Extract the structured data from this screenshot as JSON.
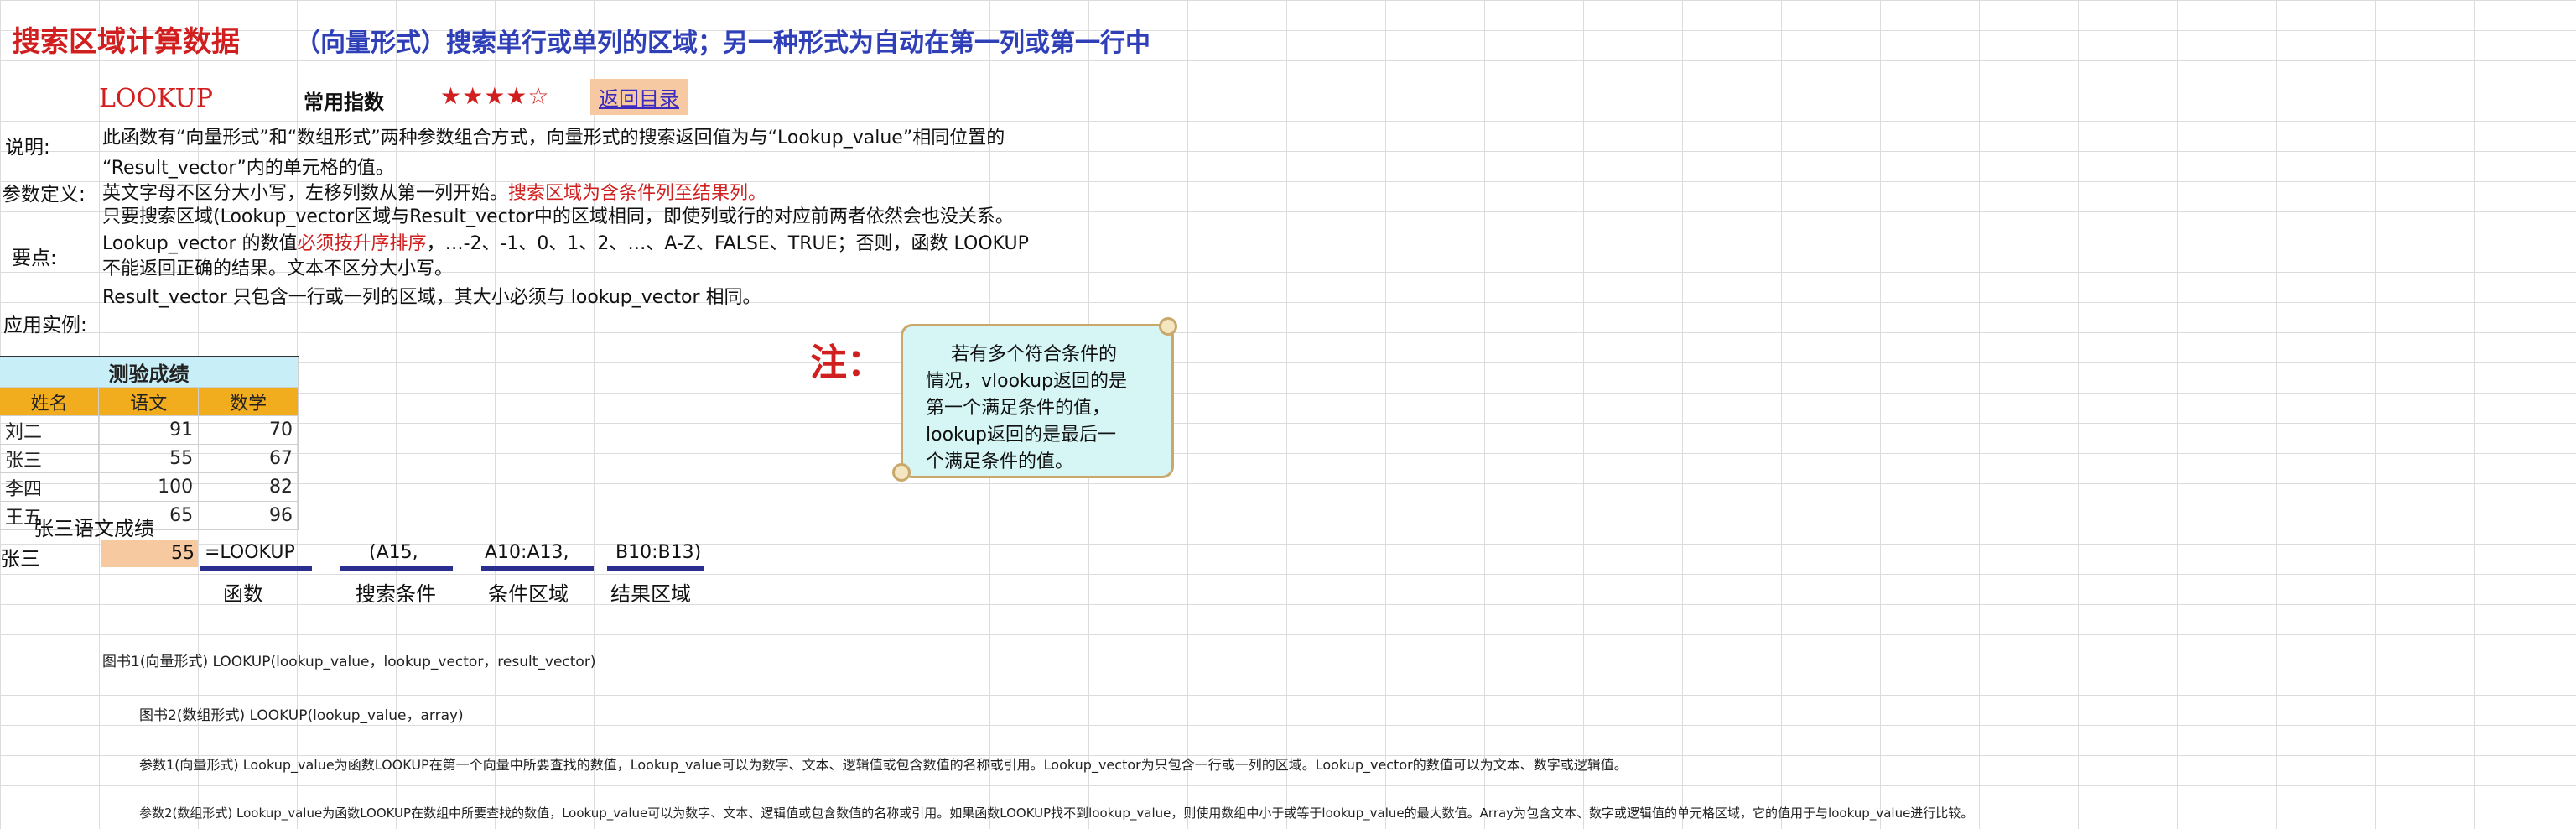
{
  "header": {
    "title_main": "搜索区域计算数据",
    "title_sub": "（向量形式）搜索单行或单列的区域；另一种形式为自动在第一列或第一行中"
  },
  "toolbar": {
    "function_name": "LOOKUP",
    "frequency_label": "常用指数",
    "stars": "★★★★☆",
    "back_label": "返回目录"
  },
  "notes": {
    "desc_label": "说明:",
    "desc_lines": [
      "此函数有“向量形式”和“数组形式”两种参数组合方式，向量形式的搜索返回值为与“Lookup_value”相同位置的",
      "“Result_vector”内的单元格的值。"
    ],
    "param_label": "参数定义:",
    "param_line_a": "英文字母不区分大小写，左移列数从第一列开始。",
    "param_line_b": "搜索区域为含条件列至结果列。",
    "points_label": "要点:",
    "points_lines": [
      "只要搜索区域(Lookup_vector区域与Result_vector中的区域相同，即使列或行的对应前两者依然会也没关系。",
      "Lookup_vector 的数值",
      "必须按升序排序",
      "，…-2、-1、0、1、2、…、A-Z、FALSE、TRUE；否则，函数 LOOKUP",
      "不能返回正确的结果。文本不区分大小写。",
      "Result_vector      只包含一行或一列的区域，其大小必须与 lookup_vector 相同。"
    ],
    "example_label": "应用实例:"
  },
  "score_table": {
    "caption": "测验成绩",
    "headers": [
      "姓名",
      "语文",
      "数学"
    ],
    "rows": [
      [
        "刘二",
        "91",
        "70"
      ],
      [
        "张三",
        "55",
        "67"
      ],
      [
        "李四",
        "100",
        "82"
      ],
      [
        "王五",
        "65",
        "96"
      ]
    ]
  },
  "lookup_demo": {
    "title": "张三语文成绩",
    "name": "张三",
    "result": "55",
    "formula_parts": [
      "=LOOKUP",
      "(A15,",
      "A10:A13,",
      "B10:B13)"
    ],
    "part_labels": [
      "函数",
      "搜索条件",
      "条件区域",
      "结果区域"
    ]
  },
  "note_box": {
    "marker": "注：",
    "lines": [
      "若有多个符合条件的",
      "情况，vlookup返回的是",
      "第一个满足条件的值，",
      "lookup返回的是最后一",
      "个满足条件的值。"
    ]
  },
  "syntax_lines": [
    "图书1(向量形式) LOOKUP(lookup_value，lookup_vector，result_vector)",
    "图书2(数组形式) LOOKUP(lookup_value，array)",
    "参数1(向量形式) Lookup_value为函数LOOKUP在第一个向量中所要查找的数值，Lookup_value可以为数字、文本、逻辑值或包含数值的名称或引用。Lookup_vector为只包含一行或一列的区域。Lookup_vector的数值可以为文本、数字或逻辑值。",
    "参数2(数组形式) Lookup_value为函数LOOKUP在数组中所要查找的数值，Lookup_value可以为数字、文本、逻辑值或包含数值的名称或引用。如果函数LOOKUP找不到lookup_value，则使用数组中小于或等于lookup_value的最大数值。Array为包含文本、数字或逻辑值的单元格区域，它的值用于与lookup_value进行比较。"
  ]
}
